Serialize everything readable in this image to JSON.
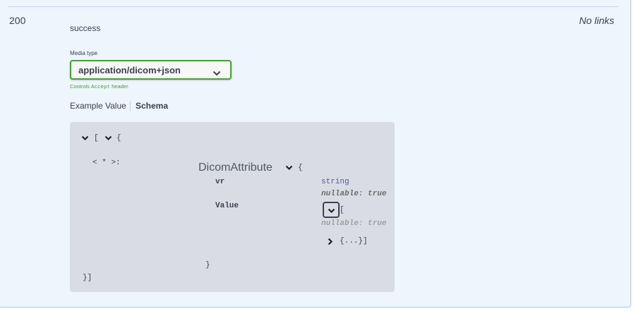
{
  "response": {
    "code": "200",
    "description": "success",
    "links": "No links"
  },
  "media_type": {
    "label": "Media type",
    "selected": "application/dicom+json",
    "hint_prefix": "Controls ",
    "hint_code": "Accept",
    "hint_suffix": " header."
  },
  "tabs": {
    "example": "Example Value",
    "schema": "Schema"
  },
  "schema_view": {
    "open_bracket": "[",
    "open_brace": "{",
    "additional_key": "< * >:",
    "model_title": "DicomAttribute",
    "model_open": "{",
    "properties": [
      {
        "name": "vr",
        "type": "string",
        "nullable": "nullable: true"
      },
      {
        "name": "Value",
        "open_bracket": "[",
        "nullable": "nullable: true",
        "collapsed_item": "{...}]"
      }
    ],
    "model_close": "}",
    "outer_close": "}]"
  },
  "colors": {
    "panel_bg": "#eef5fc",
    "panel_border": "#a8cbea",
    "select_border": "#41a32d",
    "schema_bg": "#d9dde3"
  },
  "icons": [
    "chevron-down-icon",
    "chevron-right-icon"
  ]
}
